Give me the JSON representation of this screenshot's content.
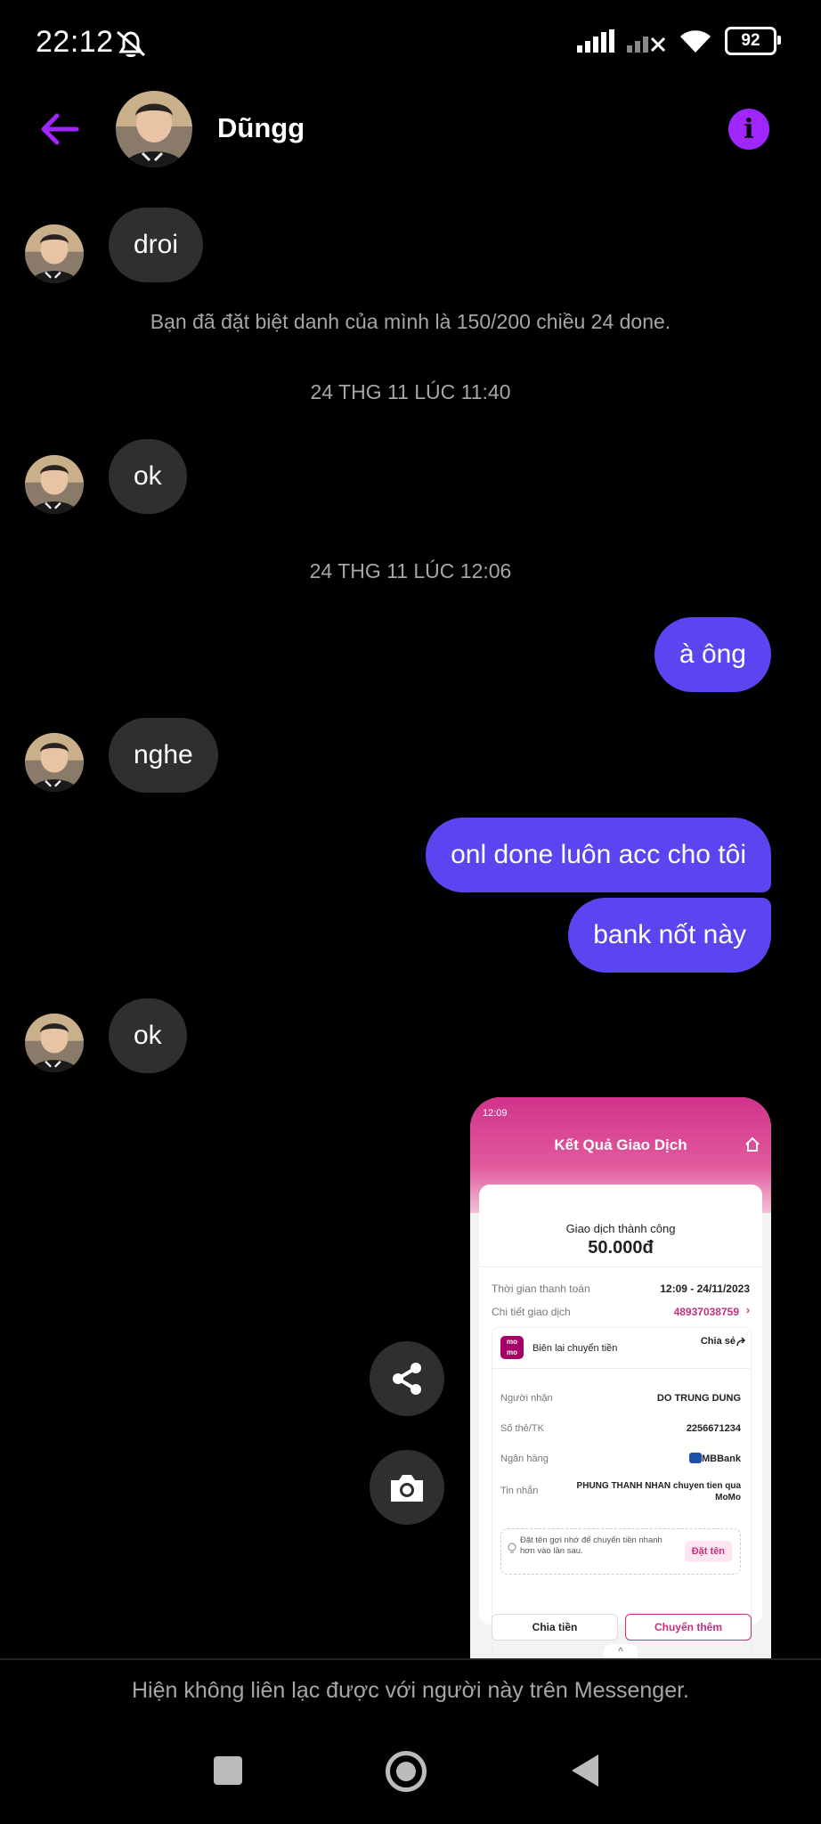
{
  "status_bar": {
    "time": "22:12",
    "battery": "92"
  },
  "header": {
    "name": "Dũngg"
  },
  "messages": {
    "m1": "droi",
    "system_nickname": "Bạn đã đặt biệt danh của mình là 150/200 chiều 24 done.",
    "timestamp1": "24 THG 11 LÚC 11:40",
    "m2": "ok",
    "timestamp2": "24 THG 11 LÚC 12:06",
    "m3": "à ông",
    "m4": "nghe",
    "m5": "onl done luôn acc cho tôi",
    "m6": "bank nốt này",
    "m7": "ok"
  },
  "receipt": {
    "status_time": "12:09",
    "title": "Kết Quả Giao Dịch",
    "success_label": "Giao dịch thành công",
    "amount": "50.000đ",
    "time_label": "Thời gian thanh toán",
    "time_value": "12:09 - 24/11/2023",
    "detail_label": "Chi tiết giao dịch",
    "detail_value": "48937038759",
    "momo_logo": "mo mo",
    "receipt_label": "Biên lai chuyển tiền",
    "share_label": "Chia sẻ",
    "recipient_label": "Người nhận",
    "recipient_value": "DO TRUNG DUNG",
    "account_label": "Số thẻ/TK",
    "account_value": "2256671234",
    "bank_label": "Ngân hàng",
    "bank_value": "MBBank",
    "message_label": "Tin nhắn",
    "message_value": "PHUNG THANH NHAN chuyen tien qua MoMo",
    "nickname_hint": "Đặt tên gợi nhớ để chuyển tiền nhanh hơn vào lần sau.",
    "nickname_button": "Đặt tên",
    "split_button": "Chia tiền",
    "transfer_more_button": "Chuyển thêm"
  },
  "footer": {
    "notice": "Hiện không liên lạc được với người này trên Messenger."
  },
  "colors": {
    "accent": "#a026ff",
    "bubble_out": "#5b45f0",
    "bubble_in": "#2f2f2f"
  }
}
